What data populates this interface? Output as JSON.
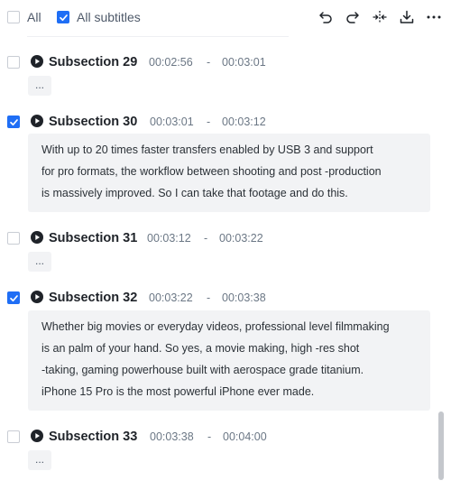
{
  "toolbar": {
    "all_label": "All",
    "all_checked": false,
    "all_subtitles_label": "All subtitles",
    "all_subtitles_checked": true,
    "tools": [
      "undo-icon",
      "redo-icon",
      "split-icon",
      "download-icon",
      "more-icon"
    ]
  },
  "subsections": [
    {
      "title": "Subsection 29",
      "start": "00:02:56",
      "sep": "-",
      "end": "00:03:01",
      "checked": false,
      "placeholder": "..."
    },
    {
      "title": "Subsection 30",
      "start": "00:03:01",
      "sep": "-",
      "end": "00:03:12",
      "checked": true,
      "lines": [
        "With up to 20 times faster transfers enabled by USB 3 and support",
        "for pro formats, the workflow between shooting and post -production",
        "is massively improved. So I can take that footage and do this."
      ]
    },
    {
      "title": "Subsection 31",
      "start": "00:03:12",
      "sep": "-",
      "end": "00:03:22",
      "checked": false,
      "placeholder": "..."
    },
    {
      "title": "Subsection 32",
      "start": "00:03:22",
      "sep": "-",
      "end": "00:03:38",
      "checked": true,
      "lines": [
        "Whether big movies or everyday videos, professional level filmmaking",
        "is an palm of your hand. So yes, a movie making, high -res shot",
        "-taking, gaming powerhouse built with aerospace grade titanium.",
        "iPhone 15 Pro is the most powerful iPhone ever made."
      ]
    },
    {
      "title": "Subsection 33",
      "start": "00:03:38",
      "sep": "-",
      "end": "00:04:00",
      "checked": false,
      "placeholder": "..."
    }
  ],
  "colors": {
    "accent": "#1f6ef5",
    "text_bg": "#f2f3f5"
  }
}
